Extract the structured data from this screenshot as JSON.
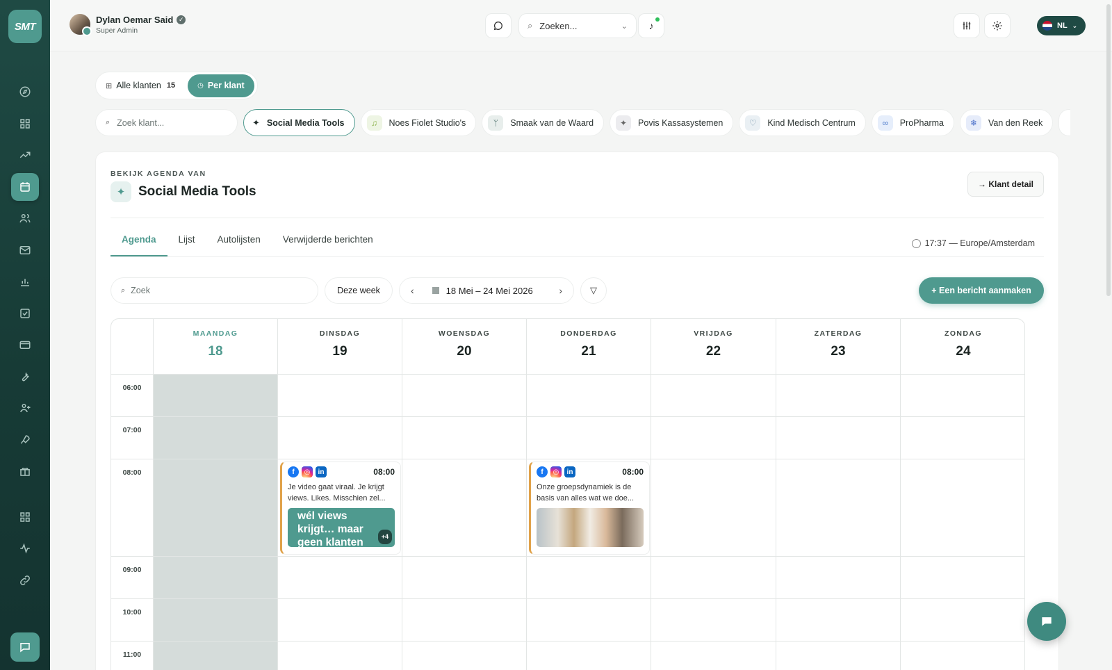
{
  "brand": {
    "logo_text": "SMT",
    "accent": "#4f9a8f",
    "sidebar_bg": "#1f4a44"
  },
  "user": {
    "name": "Dylan Oemar Said",
    "role": "Super Admin"
  },
  "topbar": {
    "search_placeholder": "Zoeken...",
    "language": "NL"
  },
  "sidebar": {
    "items": [
      {
        "icon": "compass-icon"
      },
      {
        "icon": "dashboard-icon"
      },
      {
        "icon": "trending-icon"
      },
      {
        "icon": "calendar-icon",
        "active": true
      },
      {
        "icon": "users-icon"
      },
      {
        "icon": "mail-icon"
      },
      {
        "icon": "bar-chart-icon"
      },
      {
        "icon": "checkbox-icon"
      },
      {
        "icon": "credit-card-icon"
      },
      {
        "icon": "wrench-icon"
      },
      {
        "icon": "user-plus-icon"
      },
      {
        "icon": "rocket-icon"
      },
      {
        "icon": "gift-icon"
      },
      {
        "icon": "apps-icon"
      },
      {
        "icon": "activity-icon"
      },
      {
        "icon": "link-icon"
      }
    ]
  },
  "view_toggle": {
    "all_label": "Alle klanten",
    "all_count": "15",
    "per_label": "Per klant"
  },
  "client_search_placeholder": "Zoek klant...",
  "clients": [
    {
      "name": "Social Media Tools",
      "active": true,
      "icon": "sparkle-icon"
    },
    {
      "name": "Noes Fiolet Studio's",
      "icon": "music-icon"
    },
    {
      "name": "Smaak van de Waard",
      "icon": "utensils-icon"
    },
    {
      "name": "Povis Kassasystemen",
      "icon": "sparkle-icon"
    },
    {
      "name": "Kind Medisch Centrum",
      "icon": "stethoscope-icon"
    },
    {
      "name": "ProPharma",
      "icon": "link-icon"
    },
    {
      "name": "Van den Reek",
      "icon": "snowflake-icon"
    }
  ],
  "card": {
    "eyebrow": "BEKIJK AGENDA VAN",
    "title": "Social Media Tools",
    "detail_button": "→ Klant detail",
    "tabs": [
      "Agenda",
      "Lijst",
      "Autolijsten",
      "Verwijderde berichten"
    ],
    "timezone": "17:37 — Europe/Amsterdam",
    "search_placeholder": "Zoek",
    "this_week": "Deze week",
    "date_range": "18 Mei – 24 Mei 2026",
    "create_button": "+ Een bericht aanmaken"
  },
  "calendar": {
    "days": [
      {
        "name": "MAANDAG",
        "num": "18",
        "today": true
      },
      {
        "name": "DINSDAG",
        "num": "19"
      },
      {
        "name": "WOENSDAG",
        "num": "20"
      },
      {
        "name": "DONDERDAG",
        "num": "21"
      },
      {
        "name": "VRIJDAG",
        "num": "22"
      },
      {
        "name": "ZATERDAG",
        "num": "23"
      },
      {
        "name": "ZONDAG",
        "num": "24"
      }
    ],
    "hours": [
      "06:00",
      "07:00",
      "08:00",
      "09:00",
      "10:00",
      "11:00"
    ],
    "events": [
      {
        "day": "DINSDAG",
        "time": "08:00",
        "text": "Je video gaat viraal. Je krijgt views. Likes. Misschien zel...",
        "media_text": "wél views krijgt… maar geen klanten",
        "extra": "+4",
        "networks": [
          "facebook",
          "instagram",
          "linkedin"
        ]
      },
      {
        "day": "DONDERDAG",
        "time": "08:00",
        "text": "Onze groepsdynamiek is de basis van alles wat we doe...",
        "media": "photo",
        "networks": [
          "facebook",
          "instagram",
          "linkedin"
        ]
      }
    ]
  }
}
